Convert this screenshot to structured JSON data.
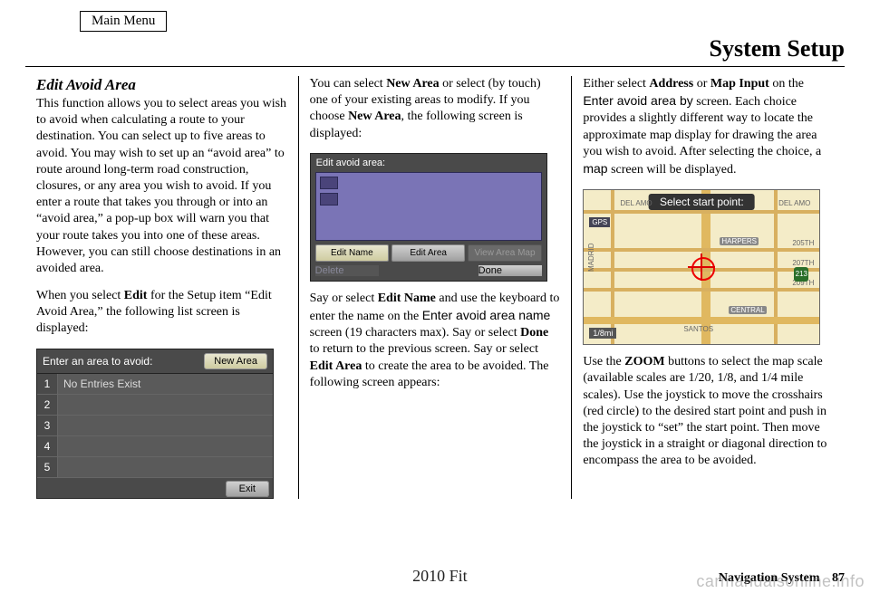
{
  "header": {
    "main_menu": "Main Menu",
    "title": "System Setup"
  },
  "col1": {
    "heading": "Edit Avoid Area",
    "p1": "This function allows you to select areas you wish to avoid when calculating a route to your destination. You can select up to five areas to avoid. You may wish to set up an “avoid area” to route around long-term road construction, closures, or any area you wish to avoid. If you enter a route that takes you through or into an “avoid area,” a pop-up box will warn you that your route takes you into one of these areas. However, you can still choose destinations in an avoided area.",
    "p2a": "When you select ",
    "p2b": "Edit",
    "p2c": " for the Setup item “Edit Avoid Area,” the following list screen is displayed:"
  },
  "screen1": {
    "title": "Enter an area to avoid:",
    "new_area": "New Area",
    "rows": [
      "1",
      "2",
      "3",
      "4",
      "5"
    ],
    "row1_text": "No Entries Exist",
    "exit": "Exit"
  },
  "col2": {
    "p1a": "You can select ",
    "p1b": "New Area",
    "p1c": " or select (by touch) one of your existing areas to modify. If you choose ",
    "p1d": "New Area",
    "p1e": ", the following screen is displayed:",
    "p2a": "Say or select ",
    "p2b": "Edit Name",
    "p2c": " and use the keyboard to enter the name on the ",
    "p2d": "Enter avoid area name",
    "p2e": " screen (19 characters max). Say or select ",
    "p2f": "Done",
    "p2g": " to return to the previous screen. Say or select ",
    "p2h": "Edit Area",
    "p2i": " to create the area to be avoided. The following screen appears:"
  },
  "screen2": {
    "title": "Edit avoid area:",
    "edit_name": "Edit Name",
    "edit_area": "Edit Area",
    "view_map": "View Area Map",
    "delete": "Delete",
    "done": "Done"
  },
  "col3": {
    "p1a": "Either select ",
    "p1b": "Address",
    "p1c": " or ",
    "p1d": "Map Input",
    "p1e": " on the ",
    "p1f": "Enter avoid area by",
    "p1g": " screen. Each choice provides a slightly different way to locate the approximate map display for drawing the area you wish to avoid. After selecting the choice, a ",
    "p1h": "map",
    "p1i": " screen will be displayed.",
    "p2a": "Use the ",
    "p2b": "ZOOM",
    "p2c": " buttons to select the map scale (available scales are 1/20, 1/8, and 1/4 mile scales). Use the joystick to move the crosshairs (red circle) to the desired start point and push in the joystick to “set” the start point. Then move the joystick in a straight or diagonal direction to encompass the area to be avoided."
  },
  "screen3": {
    "banner": "Select start point:",
    "gps": "GPS",
    "scale": "1/8mi",
    "labels": {
      "del_amo_l": "DEL AMO",
      "del_amo_r": "DEL AMO",
      "harpers": "HARPERS",
      "205th": "205TH",
      "207th": "207TH",
      "209th": "209TH",
      "central": "CENTRAL",
      "madrid": "MADRID",
      "santos": "SANTOS"
    },
    "shield": "213"
  },
  "footer": {
    "model": "2010 Fit",
    "section": "Navigation System",
    "page": "87"
  },
  "watermark": "carmanualsonline.info"
}
